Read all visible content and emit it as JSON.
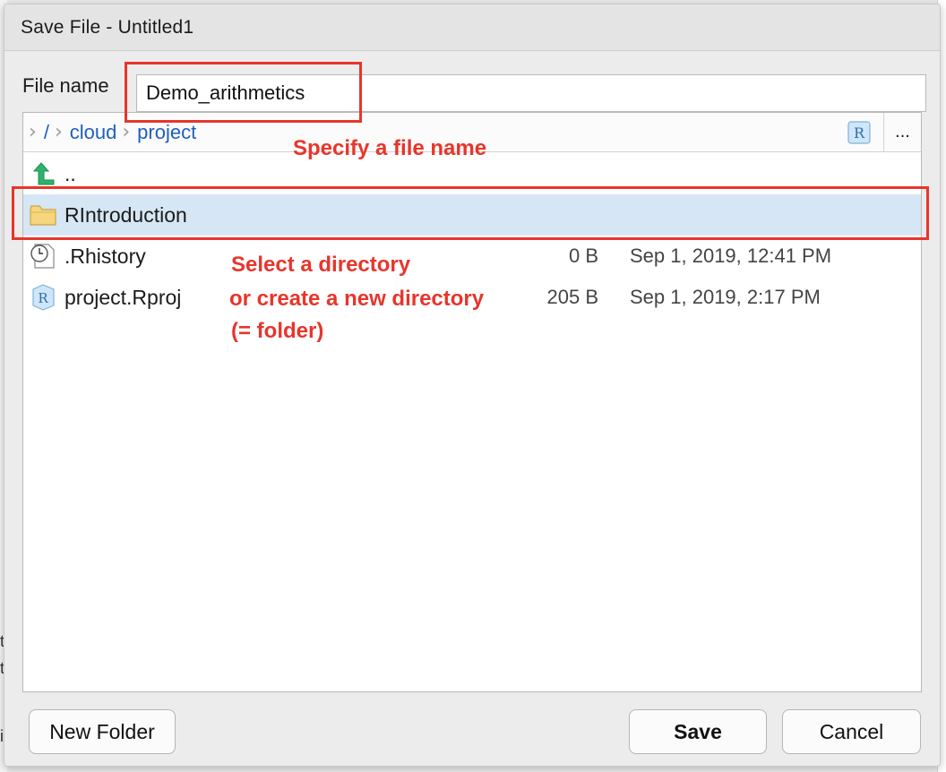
{
  "dialog": {
    "title": "Save File - Untitled1",
    "file_name_label": "File name",
    "file_name_value": "Demo_arithmetics"
  },
  "breadcrumb": {
    "root": "/",
    "items": [
      "cloud",
      "project"
    ],
    "more_label": "..."
  },
  "files": [
    {
      "name": "..",
      "size": "",
      "modified": "",
      "icon": "parent-directory-arrow-icon"
    },
    {
      "name": "RIntroduction",
      "size": "",
      "modified": "",
      "icon": "folder-icon",
      "selected": true
    },
    {
      "name": ".Rhistory",
      "size": "0 B",
      "modified": "Sep 1, 2019, 12:41 PM",
      "icon": "clock-file-icon"
    },
    {
      "name": "project.Rproj",
      "size": "205 B",
      "modified": "Sep 1, 2019, 2:17 PM",
      "icon": "rproj-icon"
    }
  ],
  "annotations": {
    "filename": "Specify a file name",
    "directory_line1": "Select a  directory",
    "directory_line2": "or create a new directory",
    "directory_line3": "(= folder)"
  },
  "buttons": {
    "new_folder": "New Folder",
    "save": "Save",
    "cancel": "Cancel"
  },
  "colors": {
    "annotation": "#e8352b",
    "link": "#1f5fbf",
    "selection": "#d6e6f4"
  }
}
